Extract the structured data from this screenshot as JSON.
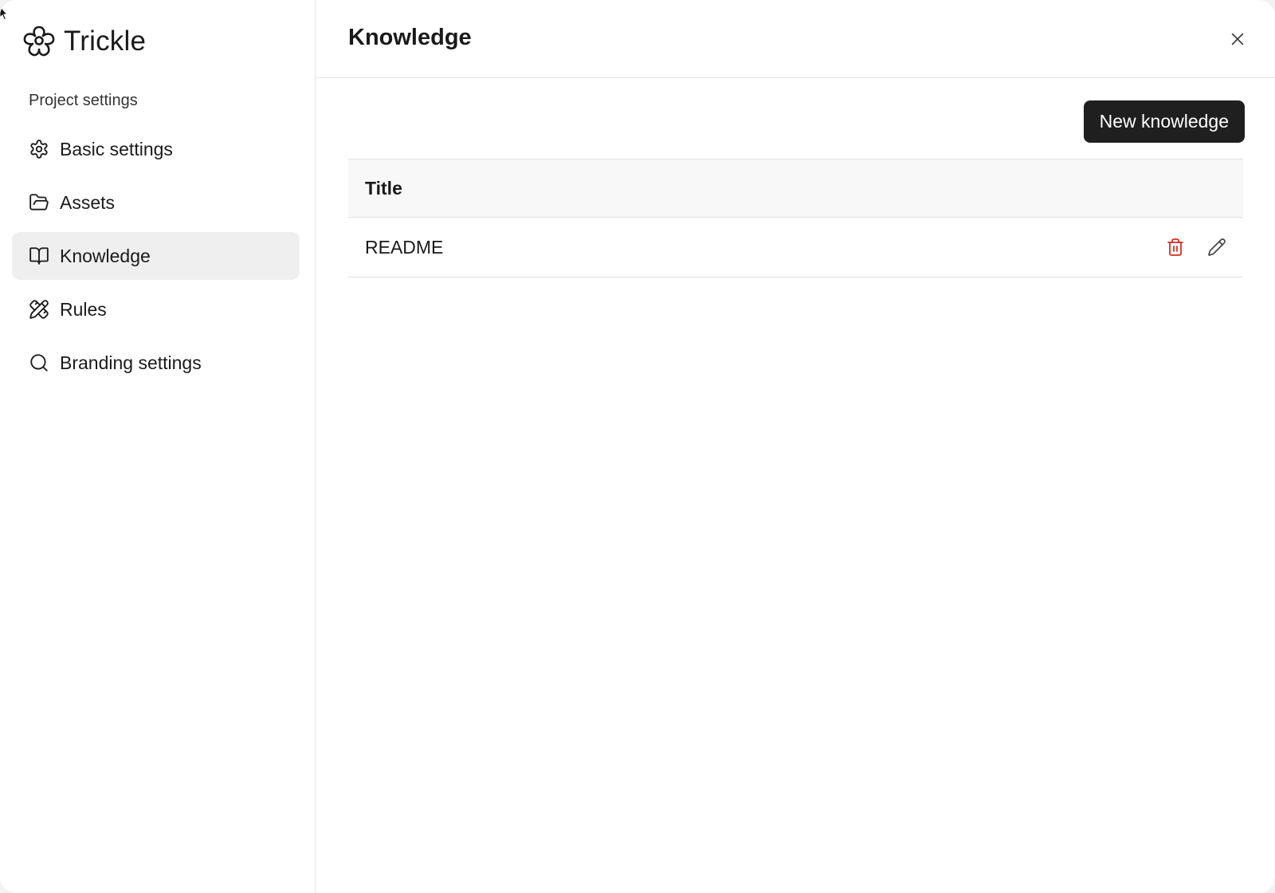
{
  "app": {
    "name": "Trickle"
  },
  "sidebar": {
    "section_label": "Project settings",
    "items": [
      {
        "label": "Basic settings",
        "icon": "gear-icon",
        "active": false
      },
      {
        "label": "Assets",
        "icon": "folder-icon",
        "active": false
      },
      {
        "label": "Knowledge",
        "icon": "book-icon",
        "active": true
      },
      {
        "label": "Rules",
        "icon": "pencil-ruler-icon",
        "active": false
      },
      {
        "label": "Branding settings",
        "icon": "search-icon",
        "active": false
      }
    ]
  },
  "header": {
    "title": "Knowledge",
    "close_icon": "close-icon"
  },
  "toolbar": {
    "new_label": "New knowledge"
  },
  "table": {
    "columns": [
      "Title"
    ],
    "rows": [
      {
        "title": "README",
        "actions": [
          "trash-icon",
          "edit-icon"
        ]
      }
    ]
  },
  "colors": {
    "primary_button": "#1f1f1f",
    "active_nav_bg": "#efefef",
    "delete_icon": "#d92d20"
  }
}
